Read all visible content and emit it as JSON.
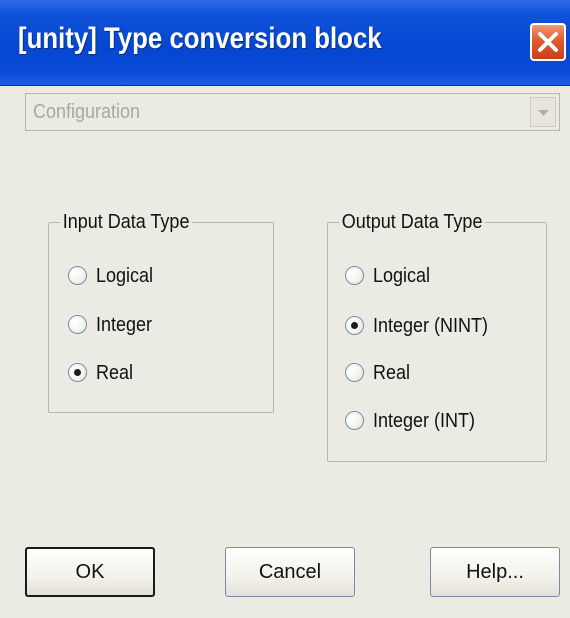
{
  "window": {
    "title": "[unity] Type conversion block",
    "close_icon": "close-icon"
  },
  "dropdown": {
    "selected": "Configuration",
    "enabled": false
  },
  "input_group": {
    "legend": "Input Data Type",
    "options": [
      {
        "label": "Logical",
        "selected": false
      },
      {
        "label": "Integer",
        "selected": false
      },
      {
        "label": "Real",
        "selected": true
      }
    ]
  },
  "output_group": {
    "legend": "Output Data Type",
    "options": [
      {
        "label": "Logical",
        "selected": false
      },
      {
        "label": "Integer (NINT)",
        "selected": true
      },
      {
        "label": "Real",
        "selected": false
      },
      {
        "label": "Integer (INT)",
        "selected": false
      }
    ]
  },
  "buttons": {
    "ok": "OK",
    "cancel": "Cancel",
    "help": "Help..."
  },
  "colors": {
    "titlebar": "#0447d1",
    "close_button": "#e25a30",
    "dialog_background": "#ecebe3"
  }
}
